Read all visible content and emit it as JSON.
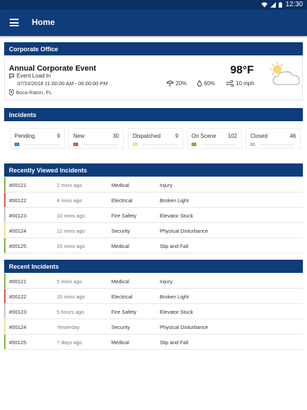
{
  "status_bar": {
    "time": "12:30"
  },
  "app_bar": {
    "title": "Home"
  },
  "corporate": {
    "header": "Corporate Office",
    "event_title": "Annual Corporate Event",
    "event_status": "Event Load In",
    "event_dates": "07/16/2018 11:00:00 AM - 06:00:00 PM",
    "location": "Boca Raton, FL",
    "temperature": "98°F",
    "precipitation": "20%",
    "humidity": "60%",
    "wind": "10 mph"
  },
  "incidents": {
    "header": "Incidents",
    "stats": [
      {
        "label": "Pending",
        "count": "9",
        "color": "#2f8fd1"
      },
      {
        "label": "New",
        "count": "30",
        "color": "#d4584a"
      },
      {
        "label": "Dispatched",
        "count": "9",
        "color": "#f5df8a"
      },
      {
        "label": "On Scene",
        "count": "102",
        "color": "#7ab53a"
      },
      {
        "label": "Closed",
        "count": "46",
        "color": "#c8c8c8"
      }
    ]
  },
  "recently_viewed": {
    "header": "Recently Viewed Incidents",
    "rows": [
      {
        "id": "#00121",
        "time": "2 mins ago",
        "type": "Medical",
        "desc": "Injury",
        "color": "#7ab53a"
      },
      {
        "id": "#00122",
        "time": "4 mins ago",
        "type": "Electrical",
        "desc": "Broken Light",
        "color": "#d4584a"
      },
      {
        "id": "#00123",
        "time": "10 mins ago",
        "type": "Fire Safety",
        "desc": "Elevator Stuck",
        "color": "#c8c8c8"
      },
      {
        "id": "#00124",
        "time": "12 mins ago",
        "type": "Security",
        "desc": "Physical Disturbance",
        "color": "#f5df8a"
      },
      {
        "id": "#00125",
        "time": "15 mins ago",
        "type": "Medical",
        "desc": "Slip and Fall",
        "color": "#7ab53a"
      }
    ]
  },
  "recent": {
    "header": "Recent Incidents",
    "rows": [
      {
        "id": "#00121",
        "time": "5 mins ago",
        "type": "Medical",
        "desc": "Injury",
        "color": "#7ab53a"
      },
      {
        "id": "#00122",
        "time": "15 mins ago",
        "type": "Electrical",
        "desc": "Broken Light",
        "color": "#d4584a"
      },
      {
        "id": "#00123",
        "time": "5 hours ago",
        "type": "Fire Safety",
        "desc": "Elevator Stuck",
        "color": "#c8c8c8"
      },
      {
        "id": "#00124",
        "time": "Yesterday",
        "type": "Security",
        "desc": "Physical Disturbance",
        "color": "#f5df8a"
      },
      {
        "id": "#00125",
        "time": "7 days ago",
        "type": "Medical",
        "desc": "Slip and Fall",
        "color": "#7ab53a"
      }
    ]
  }
}
